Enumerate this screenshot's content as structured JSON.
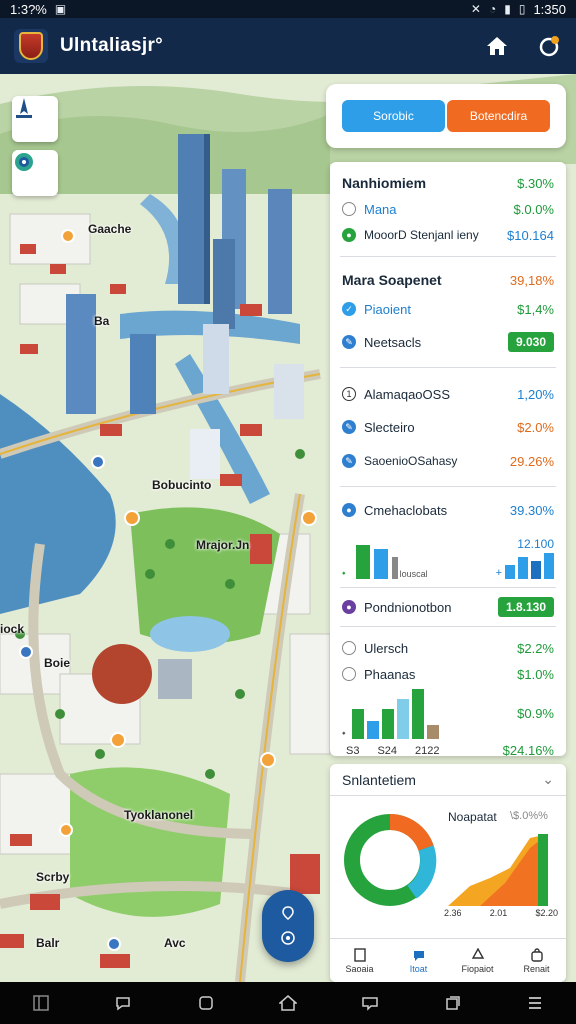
{
  "status_bar": {
    "time_left": "1:3?%",
    "time_right": "1:350"
  },
  "app": {
    "title": "Ulntaliasjr°"
  },
  "map": {
    "labels": [
      "Gaache",
      "Ba",
      "Bobucinto",
      "Mrajor.Jn",
      "Boie",
      "Tyoklanonel",
      "Scrby",
      "Avc",
      "Balr",
      "iock"
    ]
  },
  "panel": {
    "tabs": [
      "Sorobic",
      "Botencdira"
    ],
    "sections": [
      {
        "rows": [
          {
            "label": "Nanhiomiem",
            "value": "$.30%",
            "color": "green",
            "header": true
          },
          {
            "label": "Mana",
            "value": "$.0.0%",
            "color": "green"
          },
          {
            "label": "MooorD Stenjanl ieny",
            "value": "$10.164",
            "color": "blue"
          }
        ]
      },
      {
        "rows": [
          {
            "label": "Mara Soapenet",
            "value": "39,18%",
            "color": "orange",
            "header": true
          },
          {
            "label": "Piaoient",
            "value": "$1,4%",
            "color": "green"
          },
          {
            "label": "Neetsacls",
            "value": "9.030",
            "color": "badge"
          }
        ]
      },
      {
        "rows": [
          {
            "label": "AlamaqaoOSS",
            "value": "1,20%",
            "color": "blue"
          },
          {
            "label": "Slecteiro",
            "value": "$2.0%",
            "color": "orange"
          },
          {
            "label": "SaoenioOSahasy",
            "value": "29.26%",
            "color": "orange"
          }
        ]
      },
      {
        "rows": [
          {
            "label": "Cmehaclobats",
            "value": "39.30%",
            "color": "blue"
          }
        ],
        "chart": {
          "left_caption": "louscal",
          "right_value": "12.100"
        }
      },
      {
        "rows": [
          {
            "label": "Pondnionotbon",
            "value": "1.8.130",
            "color": "badge"
          }
        ]
      },
      {
        "rows": [
          {
            "label": "Ulersch",
            "value": "$2.2%",
            "color": "green"
          },
          {
            "label": "Phaanas",
            "value": "$1.0%",
            "color": "green"
          }
        ],
        "chart": {
          "right_value": "$0.9%",
          "axis_labels": [
            "S3",
            "S24",
            "2122"
          ],
          "total": "$24.16%"
        }
      }
    ]
  },
  "summary": {
    "title": "Snlantetiem",
    "right_label": "Noapatat",
    "right_value": "\\$.0%%",
    "axis_labels": [
      "2.36",
      "2.01",
      "$2.20"
    ],
    "tabs": [
      "Saoaia",
      "Itoat",
      "Fiopaiot",
      "Renait"
    ]
  },
  "colors": {
    "primary": "#13294a",
    "accent_blue": "#2f9ee8",
    "accent_orange": "#f06a21",
    "green": "#27a33e"
  }
}
